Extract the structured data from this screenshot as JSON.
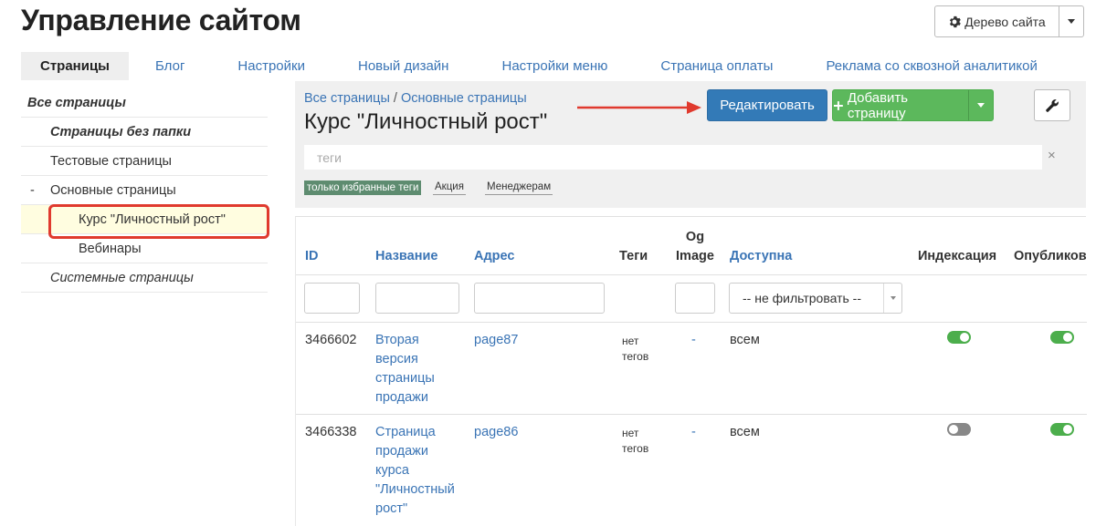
{
  "header": {
    "title": "Управление сайтом",
    "site_tree_label": "Дерево сайта"
  },
  "tabs": [
    {
      "label": "Страницы"
    },
    {
      "label": "Блог"
    },
    {
      "label": "Настройки"
    },
    {
      "label": "Новый дизайн"
    },
    {
      "label": "Настройки меню"
    },
    {
      "label": "Страница оплаты"
    },
    {
      "label": "Реклама со сквозной аналитикой"
    }
  ],
  "sidebar": {
    "items": [
      {
        "label": "Все страницы"
      },
      {
        "label": "Страницы без папки"
      },
      {
        "label": "Тестовые страницы"
      },
      {
        "label": "Основные страницы",
        "prefix": "-"
      },
      {
        "label": "Курс \"Личностный рост\""
      },
      {
        "label": "Вебинары"
      },
      {
        "label": "Системные страницы"
      }
    ]
  },
  "content": {
    "breadcrumb_root": "Все страницы",
    "breadcrumb_sep": " / ",
    "breadcrumb_current": "Основные страницы",
    "title": "Курс \"Личностный рост\"",
    "edit_label": "Редактировать",
    "add_label": "Добавить страницу",
    "tags_placeholder": "теги",
    "tags_clear": "×",
    "fav_tags_label": "только избранные теги",
    "tags": [
      "Акция",
      "Менеджерам"
    ]
  },
  "table": {
    "headers": {
      "id": "ID",
      "name": "Название",
      "address": "Адрес",
      "tags": "Теги",
      "og_image_line1": "Og",
      "og_image_line2": "Image",
      "available": "Доступна",
      "indexing": "Индексация",
      "published": "Опубликов"
    },
    "filter_select": "-- не фильтровать --",
    "rows": [
      {
        "id": "3466602",
        "name_lines": [
          "Вторая",
          "версия",
          "страницы",
          "продажи"
        ],
        "address": "page87",
        "tags_lines": [
          "нет",
          "тегов"
        ],
        "og_image": "-",
        "available": "всем",
        "indexing": true,
        "published": true
      },
      {
        "id": "3466338",
        "name_lines": [
          "Страница",
          "продажи",
          "курса",
          "\"Личностный",
          "рост\""
        ],
        "address": "page86",
        "tags_lines": [
          "нет",
          "тегов"
        ],
        "og_image": "-",
        "available": "всем",
        "indexing": false,
        "published": true
      }
    ]
  }
}
